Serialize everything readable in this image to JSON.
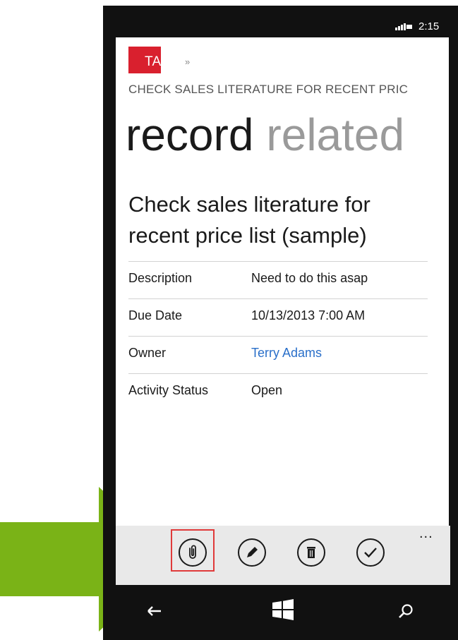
{
  "status_bar": {
    "time": "2:15",
    "signal_icon": "signal-strength-icon"
  },
  "header": {
    "entity_badge": "TASK",
    "entity_badge_accent": "#d9202e",
    "chevron": "»",
    "entity_title": "CHECK SALES LITERATURE FOR RECENT PRIC"
  },
  "pivot": {
    "tabs": [
      {
        "label": "record",
        "active": true
      },
      {
        "label": "related",
        "active": false
      }
    ]
  },
  "record": {
    "heading": "Check sales literature for recent price list (sample)",
    "fields": [
      {
        "label": "Description",
        "value": "Need to do this asap",
        "is_link": false
      },
      {
        "label": "Due Date",
        "value": "10/13/2013 7:00 AM",
        "is_link": false
      },
      {
        "label": "Owner",
        "value": "Terry Adams",
        "is_link": true
      },
      {
        "label": "Activity Status",
        "value": "Open",
        "is_link": false
      }
    ]
  },
  "app_bar": {
    "buttons": [
      {
        "icon": "paperclip-icon",
        "highlighted": true
      },
      {
        "icon": "edit-pencil-icon",
        "highlighted": false
      },
      {
        "icon": "delete-trash-icon",
        "highlighted": false
      },
      {
        "icon": "checkmark-icon",
        "highlighted": false
      }
    ],
    "more": "...",
    "highlight_color": "#e03a3a"
  },
  "nav_bar": {
    "back_icon": "back-arrow-icon",
    "start_icon": "windows-logo-icon",
    "search_icon": "search-icon"
  },
  "annotation": {
    "arrow_color": "#7ab317"
  }
}
